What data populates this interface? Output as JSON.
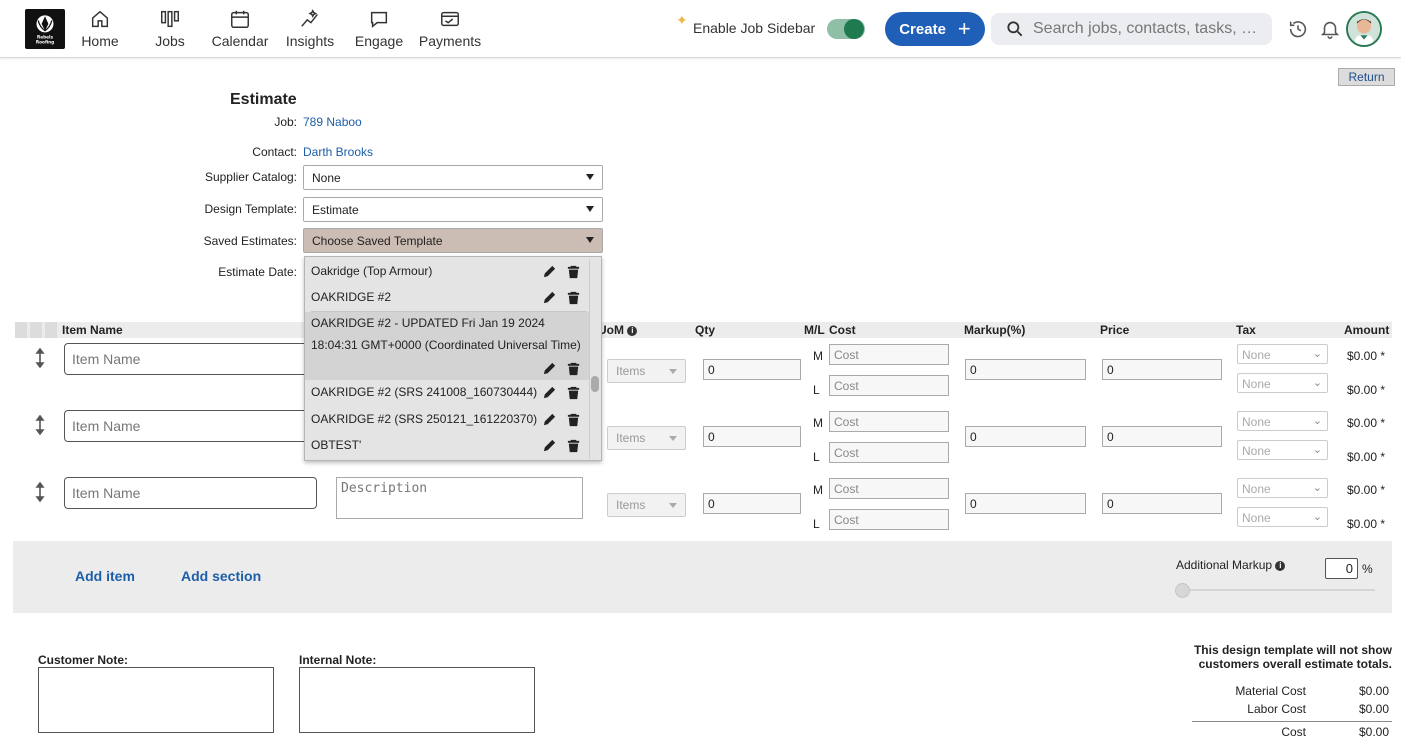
{
  "nav": {
    "items": [
      {
        "label": "Home",
        "icon": "home-icon"
      },
      {
        "label": "Jobs",
        "icon": "jobs-icon"
      },
      {
        "label": "Calendar",
        "icon": "calendar-icon"
      },
      {
        "label": "Insights",
        "icon": "insights-icon"
      },
      {
        "label": "Engage",
        "icon": "engage-icon"
      },
      {
        "label": "Payments",
        "icon": "payments-icon"
      }
    ],
    "sidebar_toggle_label": "Enable Job Sidebar",
    "sidebar_enabled": true,
    "create_label": "Create",
    "search_placeholder": "Search jobs, contacts, tasks, …",
    "logo_text": "Rebels Roofing"
  },
  "return_label": "Return",
  "estimate": {
    "title": "Estimate",
    "job_label": "Job:",
    "job_value": "789 Naboo",
    "contact_label": "Contact:",
    "contact_value": "Darth Brooks",
    "supplier_label": "Supplier Catalog:",
    "supplier_value": "None",
    "design_label": "Design Template:",
    "design_value": "Estimate",
    "saved_label": "Saved Estimates:",
    "saved_value": "Choose Saved Template",
    "date_label": "Estimate Date:"
  },
  "saved_templates": [
    {
      "text": "Oakridge (Top Armour)"
    },
    {
      "text": "OAKRIDGE #2"
    },
    {
      "text": "OAKRIDGE #2 - UPDATED Fri Jan 19 2024 18:04:31 GMT+0000 (Coordinated Universal Time)"
    },
    {
      "text": "OAKRIDGE #2 (SRS 241008_160730444)"
    },
    {
      "text": "OAKRIDGE #2 (SRS 250121_161220370)"
    },
    {
      "text": "OBTEST'"
    }
  ],
  "table": {
    "headers": {
      "item_name": "Item Name",
      "uom": "UoM",
      "qty": "Qty",
      "ml": "M/L",
      "cost": "Cost",
      "markup": "Markup(%)",
      "price": "Price",
      "tax": "Tax",
      "amount": "Amount"
    },
    "rows": [
      {
        "item_placeholder": "Item Name",
        "desc_placeholder": "Description",
        "uom": "Items",
        "qty": "0",
        "m_label": "M",
        "l_label": "L",
        "m_cost_placeholder": "Cost",
        "l_cost_placeholder": "Cost",
        "markup": "0",
        "price": "0",
        "tax_m": "None",
        "tax_l": "None",
        "amount_m": "$0.00 *",
        "amount_l": "$0.00 *"
      },
      {
        "item_placeholder": "Item Name",
        "desc_placeholder": "Description",
        "uom": "Items",
        "qty": "0",
        "m_label": "M",
        "l_label": "L",
        "m_cost_placeholder": "Cost",
        "l_cost_placeholder": "Cost",
        "markup": "0",
        "price": "0",
        "tax_m": "None",
        "tax_l": "None",
        "amount_m": "$0.00 *",
        "amount_l": "$0.00 *"
      },
      {
        "item_placeholder": "Item Name",
        "desc_placeholder": "Description",
        "uom": "Items",
        "qty": "0",
        "m_label": "M",
        "l_label": "L",
        "m_cost_placeholder": "Cost",
        "l_cost_placeholder": "Cost",
        "markup": "0",
        "price": "0",
        "tax_m": "None",
        "tax_l": "None",
        "amount_m": "$0.00 *",
        "amount_l": "$0.00 *"
      }
    ]
  },
  "actions": {
    "add_item": "Add item",
    "add_section": "Add section",
    "additional_markup_label": "Additional Markup",
    "additional_markup_value": "0",
    "percent_symbol": "%"
  },
  "notes": {
    "customer_label": "Customer Note:",
    "internal_label": "Internal Note:"
  },
  "totals": {
    "notice": "This design template will not show customers overall estimate totals.",
    "material_cost_label": "Material Cost",
    "material_cost_value": "$0.00",
    "labor_cost_label": "Labor Cost",
    "labor_cost_value": "$0.00",
    "cost_label": "Cost",
    "cost_value": "$0.00"
  },
  "colors": {
    "brand_blue": "#1f5fb8",
    "link_blue": "#1d5ea8",
    "toggle_green": "#1f7a4f"
  }
}
